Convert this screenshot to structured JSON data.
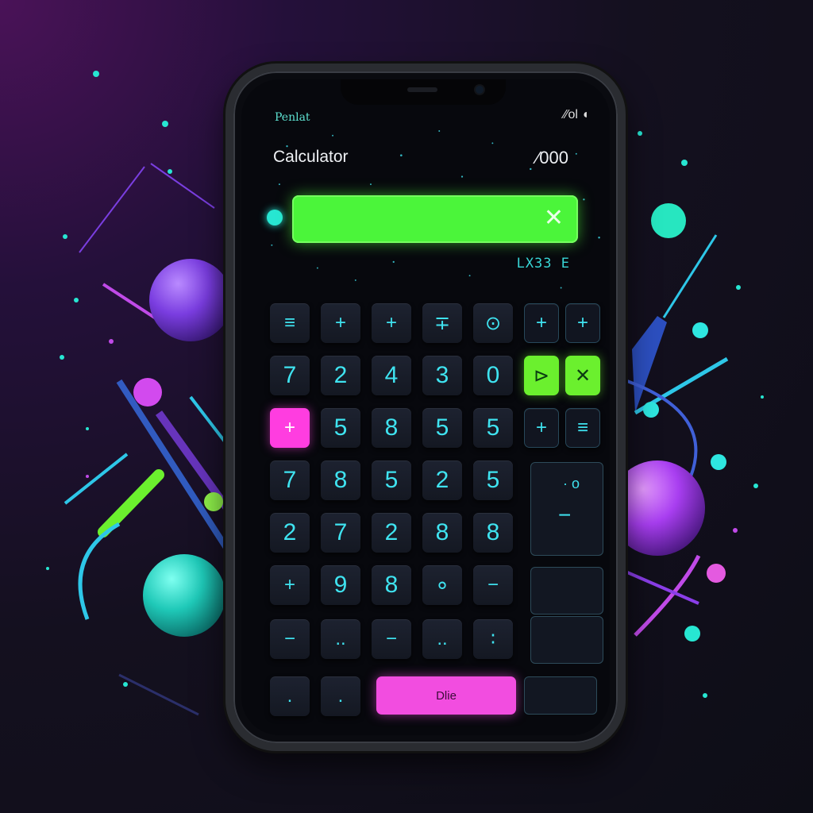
{
  "colors": {
    "accent_green": "#4bf53a",
    "accent_pink": "#f24de0",
    "accent_cyan": "#3fe3f0",
    "accent_purple": "#8a3ee8",
    "background": "#14101f"
  },
  "status_bar": {
    "carrier": "Penlat",
    "icons": "∕∕ol ◖"
  },
  "header": {
    "title": "Calculator",
    "value": "∕000"
  },
  "display": {
    "value": "",
    "clear_icon": "✕",
    "expression": "LX33 E"
  },
  "keypad": {
    "row1": [
      "≡",
      "+",
      "+",
      "∓",
      "⊙",
      "+",
      "+"
    ],
    "row2": [
      "7",
      "2",
      "4",
      "3",
      "0",
      "⊳",
      "✕"
    ],
    "row3": [
      "+",
      "5",
      "8",
      "5",
      "5",
      "+",
      "≡"
    ],
    "row4": [
      "7",
      "8",
      "5",
      "2",
      "5"
    ],
    "row5": [
      "2",
      "7",
      "2",
      "8",
      "8"
    ],
    "row6": [
      "+",
      "9",
      "8",
      "∘",
      "−"
    ],
    "row7": [
      "−",
      "..",
      "−",
      "..",
      "∶"
    ],
    "row8": [
      ".",
      "."
    ],
    "tall_top": "· o",
    "tall_bottom": "−",
    "done_label": "Dlie"
  }
}
